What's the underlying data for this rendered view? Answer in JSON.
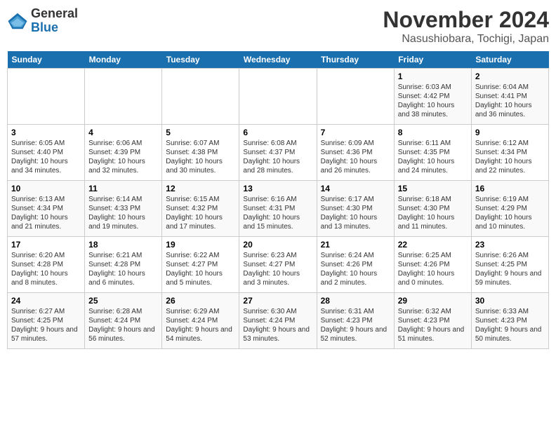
{
  "logo": {
    "text_general": "General",
    "text_blue": "Blue"
  },
  "title": "November 2024",
  "subtitle": "Nasushiobara, Tochigi, Japan",
  "days_of_week": [
    "Sunday",
    "Monday",
    "Tuesday",
    "Wednesday",
    "Thursday",
    "Friday",
    "Saturday"
  ],
  "weeks": [
    [
      {
        "day": "",
        "info": ""
      },
      {
        "day": "",
        "info": ""
      },
      {
        "day": "",
        "info": ""
      },
      {
        "day": "",
        "info": ""
      },
      {
        "day": "",
        "info": ""
      },
      {
        "day": "1",
        "info": "Sunrise: 6:03 AM\nSunset: 4:42 PM\nDaylight: 10 hours and 38 minutes."
      },
      {
        "day": "2",
        "info": "Sunrise: 6:04 AM\nSunset: 4:41 PM\nDaylight: 10 hours and 36 minutes."
      }
    ],
    [
      {
        "day": "3",
        "info": "Sunrise: 6:05 AM\nSunset: 4:40 PM\nDaylight: 10 hours and 34 minutes."
      },
      {
        "day": "4",
        "info": "Sunrise: 6:06 AM\nSunset: 4:39 PM\nDaylight: 10 hours and 32 minutes."
      },
      {
        "day": "5",
        "info": "Sunrise: 6:07 AM\nSunset: 4:38 PM\nDaylight: 10 hours and 30 minutes."
      },
      {
        "day": "6",
        "info": "Sunrise: 6:08 AM\nSunset: 4:37 PM\nDaylight: 10 hours and 28 minutes."
      },
      {
        "day": "7",
        "info": "Sunrise: 6:09 AM\nSunset: 4:36 PM\nDaylight: 10 hours and 26 minutes."
      },
      {
        "day": "8",
        "info": "Sunrise: 6:11 AM\nSunset: 4:35 PM\nDaylight: 10 hours and 24 minutes."
      },
      {
        "day": "9",
        "info": "Sunrise: 6:12 AM\nSunset: 4:34 PM\nDaylight: 10 hours and 22 minutes."
      }
    ],
    [
      {
        "day": "10",
        "info": "Sunrise: 6:13 AM\nSunset: 4:34 PM\nDaylight: 10 hours and 21 minutes."
      },
      {
        "day": "11",
        "info": "Sunrise: 6:14 AM\nSunset: 4:33 PM\nDaylight: 10 hours and 19 minutes."
      },
      {
        "day": "12",
        "info": "Sunrise: 6:15 AM\nSunset: 4:32 PM\nDaylight: 10 hours and 17 minutes."
      },
      {
        "day": "13",
        "info": "Sunrise: 6:16 AM\nSunset: 4:31 PM\nDaylight: 10 hours and 15 minutes."
      },
      {
        "day": "14",
        "info": "Sunrise: 6:17 AM\nSunset: 4:30 PM\nDaylight: 10 hours and 13 minutes."
      },
      {
        "day": "15",
        "info": "Sunrise: 6:18 AM\nSunset: 4:30 PM\nDaylight: 10 hours and 11 minutes."
      },
      {
        "day": "16",
        "info": "Sunrise: 6:19 AM\nSunset: 4:29 PM\nDaylight: 10 hours and 10 minutes."
      }
    ],
    [
      {
        "day": "17",
        "info": "Sunrise: 6:20 AM\nSunset: 4:28 PM\nDaylight: 10 hours and 8 minutes."
      },
      {
        "day": "18",
        "info": "Sunrise: 6:21 AM\nSunset: 4:28 PM\nDaylight: 10 hours and 6 minutes."
      },
      {
        "day": "19",
        "info": "Sunrise: 6:22 AM\nSunset: 4:27 PM\nDaylight: 10 hours and 5 minutes."
      },
      {
        "day": "20",
        "info": "Sunrise: 6:23 AM\nSunset: 4:27 PM\nDaylight: 10 hours and 3 minutes."
      },
      {
        "day": "21",
        "info": "Sunrise: 6:24 AM\nSunset: 4:26 PM\nDaylight: 10 hours and 2 minutes."
      },
      {
        "day": "22",
        "info": "Sunrise: 6:25 AM\nSunset: 4:26 PM\nDaylight: 10 hours and 0 minutes."
      },
      {
        "day": "23",
        "info": "Sunrise: 6:26 AM\nSunset: 4:25 PM\nDaylight: 9 hours and 59 minutes."
      }
    ],
    [
      {
        "day": "24",
        "info": "Sunrise: 6:27 AM\nSunset: 4:25 PM\nDaylight: 9 hours and 57 minutes."
      },
      {
        "day": "25",
        "info": "Sunrise: 6:28 AM\nSunset: 4:24 PM\nDaylight: 9 hours and 56 minutes."
      },
      {
        "day": "26",
        "info": "Sunrise: 6:29 AM\nSunset: 4:24 PM\nDaylight: 9 hours and 54 minutes."
      },
      {
        "day": "27",
        "info": "Sunrise: 6:30 AM\nSunset: 4:24 PM\nDaylight: 9 hours and 53 minutes."
      },
      {
        "day": "28",
        "info": "Sunrise: 6:31 AM\nSunset: 4:23 PM\nDaylight: 9 hours and 52 minutes."
      },
      {
        "day": "29",
        "info": "Sunrise: 6:32 AM\nSunset: 4:23 PM\nDaylight: 9 hours and 51 minutes."
      },
      {
        "day": "30",
        "info": "Sunrise: 6:33 AM\nSunset: 4:23 PM\nDaylight: 9 hours and 50 minutes."
      }
    ]
  ]
}
